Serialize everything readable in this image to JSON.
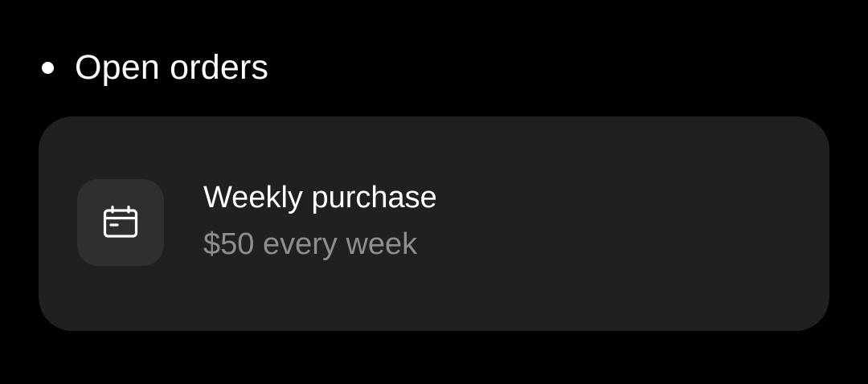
{
  "section": {
    "title": "Open orders"
  },
  "order": {
    "icon": "calendar-icon",
    "title": "Weekly purchase",
    "subtitle": "$50 every week"
  },
  "colors": {
    "background": "#000000",
    "card": "#202020",
    "icon_tile": "#2f2f2f",
    "primary_text": "#ffffff",
    "secondary_text": "#8e8e8e"
  }
}
